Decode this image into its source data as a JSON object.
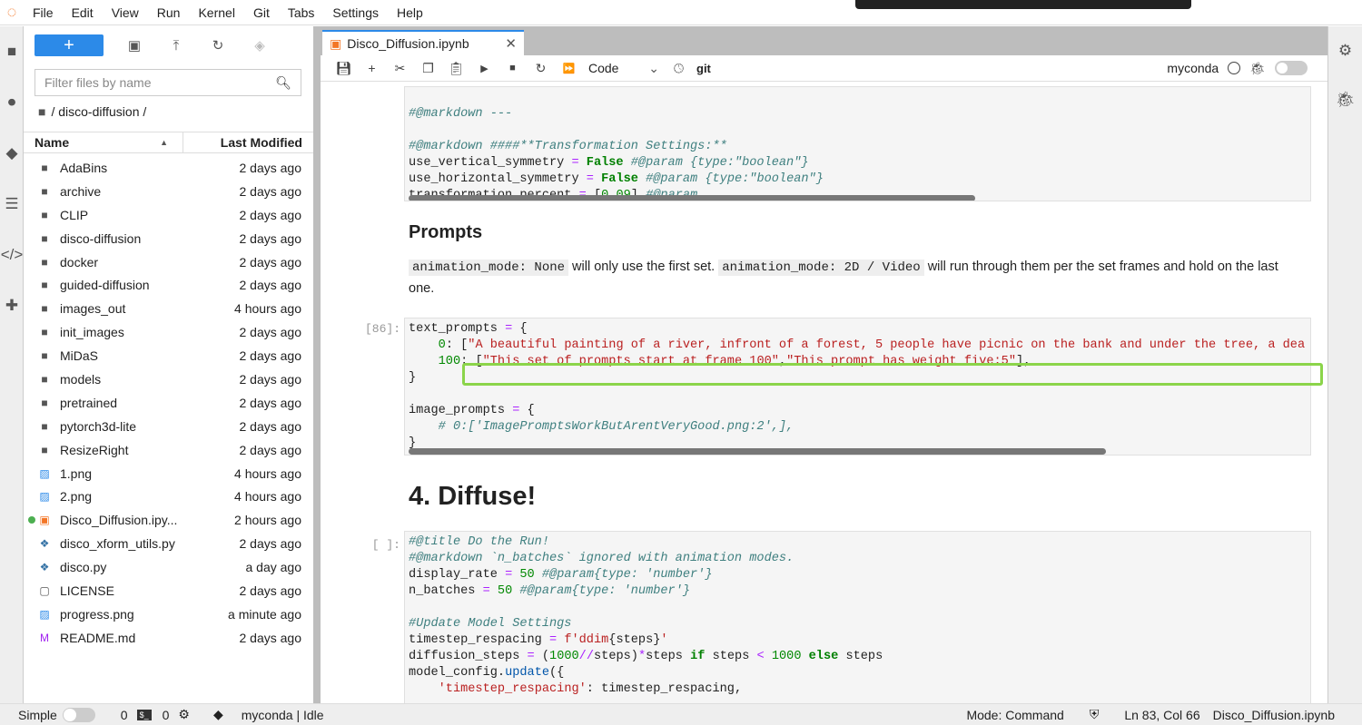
{
  "menu": [
    "File",
    "Edit",
    "View",
    "Run",
    "Kernel",
    "Git",
    "Tabs",
    "Settings",
    "Help"
  ],
  "filebrowser": {
    "filter_placeholder": "Filter files by name",
    "breadcrumb": "/ disco-diffusion /",
    "col_name": "Name",
    "col_modified": "Last Modified",
    "files": [
      {
        "name": "AdaBins",
        "modified": "2 days ago",
        "type": "folder"
      },
      {
        "name": "archive",
        "modified": "2 days ago",
        "type": "folder"
      },
      {
        "name": "CLIP",
        "modified": "2 days ago",
        "type": "folder"
      },
      {
        "name": "disco-diffusion",
        "modified": "2 days ago",
        "type": "folder"
      },
      {
        "name": "docker",
        "modified": "2 days ago",
        "type": "folder"
      },
      {
        "name": "guided-diffusion",
        "modified": "2 days ago",
        "type": "folder"
      },
      {
        "name": "images_out",
        "modified": "4 hours ago",
        "type": "folder"
      },
      {
        "name": "init_images",
        "modified": "2 days ago",
        "type": "folder"
      },
      {
        "name": "MiDaS",
        "modified": "2 days ago",
        "type": "folder"
      },
      {
        "name": "models",
        "modified": "2 days ago",
        "type": "folder"
      },
      {
        "name": "pretrained",
        "modified": "2 days ago",
        "type": "folder"
      },
      {
        "name": "pytorch3d-lite",
        "modified": "2 days ago",
        "type": "folder"
      },
      {
        "name": "ResizeRight",
        "modified": "2 days ago",
        "type": "folder"
      },
      {
        "name": "1.png",
        "modified": "4 hours ago",
        "type": "image"
      },
      {
        "name": "2.png",
        "modified": "4 hours ago",
        "type": "image"
      },
      {
        "name": "Disco_Diffusion.ipy...",
        "modified": "2 hours ago",
        "type": "notebook",
        "running": true
      },
      {
        "name": "disco_xform_utils.py",
        "modified": "2 days ago",
        "type": "python"
      },
      {
        "name": "disco.py",
        "modified": "a day ago",
        "type": "python"
      },
      {
        "name": "LICENSE",
        "modified": "2 days ago",
        "type": "file"
      },
      {
        "name": "progress.png",
        "modified": "a minute ago",
        "type": "image"
      },
      {
        "name": "README.md",
        "modified": "2 days ago",
        "type": "markdown"
      }
    ]
  },
  "notebook": {
    "tab_title": "Disco_Diffusion.ipynb",
    "cell_type": "Code",
    "git_label": "git",
    "kernel": "myconda",
    "cell1": [
      [],
      [
        [
          "cm",
          "#@markdown ---"
        ]
      ],
      [],
      [
        [
          "cm",
          "#@markdown ####**Transformation Settings:**"
        ]
      ],
      [
        [
          "",
          "use_vertical_symmetry "
        ],
        [
          "op",
          "="
        ],
        [
          "kw",
          " False"
        ],
        [
          "cm",
          " #@param {type:\"boolean\"}"
        ]
      ],
      [
        [
          "",
          "use_horizontal_symmetry "
        ],
        [
          "op",
          "="
        ],
        [
          "kw",
          " False"
        ],
        [
          "cm",
          " #@param {type:\"boolean\"}"
        ]
      ],
      [
        [
          "",
          "transformation_percent "
        ],
        [
          "op",
          "="
        ],
        [
          "",
          " ["
        ],
        [
          "num",
          "0.09"
        ],
        [
          "",
          "] "
        ],
        [
          "cm",
          "#@param"
        ]
      ]
    ],
    "prompts_heading": "Prompts",
    "prompts_md": {
      "code1": "animation_mode: None",
      "text1": " will only use the first set. ",
      "code2": "animation_mode: 2D / Video",
      "text2": " will run through them per the set frames and hold on the last one."
    },
    "cell2_prompt": "[86]:",
    "cell2": [
      [
        [
          "",
          "text_prompts "
        ],
        [
          "op",
          "="
        ],
        [
          "",
          " {"
        ]
      ],
      [
        [
          "",
          "    "
        ],
        [
          "num",
          "0"
        ],
        [
          "",
          ": ["
        ],
        [
          "str",
          "\"A beautiful painting of a river, infront of a forest, 5 people have picnic on the bank and under the tree, a dea"
        ]
      ],
      [
        [
          "",
          "    "
        ],
        [
          "num",
          "100"
        ],
        [
          "",
          ": ["
        ],
        [
          "str",
          "\"This set of prompts start at frame 100\""
        ],
        [
          "",
          ","
        ],
        [
          "str",
          "\"This prompt has weight five:5\""
        ],
        [
          "",
          "],"
        ]
      ],
      [
        [
          "",
          "}"
        ]
      ],
      [],
      [
        [
          "",
          "image_prompts "
        ],
        [
          "op",
          "="
        ],
        [
          "",
          " {"
        ]
      ],
      [
        [
          "",
          "    "
        ],
        [
          "cm",
          "# 0:['ImagePromptsWorkButArentVeryGood.png:2',],"
        ]
      ],
      [
        [
          "",
          "}"
        ]
      ]
    ],
    "diffuse_heading": "4. Diffuse!",
    "cell3_prompt": "[ ]:",
    "cell3": [
      [
        [
          "cm",
          "#@title Do the Run!"
        ]
      ],
      [
        [
          "cm",
          "#@markdown `n_batches` ignored with animation modes."
        ]
      ],
      [
        [
          "",
          "display_rate "
        ],
        [
          "op",
          "="
        ],
        [
          "num",
          " 50"
        ],
        [
          "cm",
          " #@param{type: 'number'}"
        ]
      ],
      [
        [
          "",
          "n_batches "
        ],
        [
          "op",
          "="
        ],
        [
          "num",
          " 50"
        ],
        [
          "cm",
          " #@param{type: 'number'}"
        ]
      ],
      [],
      [
        [
          "cm",
          "#Update Model Settings"
        ]
      ],
      [
        [
          "",
          "timestep_respacing "
        ],
        [
          "op",
          "="
        ],
        [
          "str",
          " f'ddim"
        ],
        [
          "",
          "{steps}"
        ],
        [
          "str",
          "'"
        ]
      ],
      [
        [
          "",
          "diffusion_steps "
        ],
        [
          "op",
          "="
        ],
        [
          "",
          " ("
        ],
        [
          "num",
          "1000"
        ],
        [
          "op",
          "//"
        ],
        [
          "",
          "steps)"
        ],
        [
          "op",
          "*"
        ],
        [
          "",
          "steps "
        ],
        [
          "kw",
          "if"
        ],
        [
          "",
          " steps "
        ],
        [
          "op",
          "<"
        ],
        [
          "num",
          " 1000"
        ],
        [
          "kw",
          " else"
        ],
        [
          "",
          " steps"
        ]
      ],
      [
        [
          "",
          "model_config."
        ],
        [
          "fn",
          "update"
        ],
        [
          "",
          "({"
        ]
      ],
      [
        [
          "",
          "    "
        ],
        [
          "str",
          "'timestep_respacing'"
        ],
        [
          "",
          ": timestep_respacing,"
        ]
      ]
    ]
  },
  "status": {
    "mode_simple": "Simple",
    "terminals": "0",
    "kernels": "0",
    "kernel_status": "myconda | Idle",
    "mode": "Mode: Command",
    "cursor": "Ln 83, Col 66",
    "filename": "Disco_Diffusion.ipynb"
  },
  "colors": {
    "accent": "#2c8ae8",
    "highlight": "#8bd44a",
    "running_dot": "#4caf50"
  }
}
